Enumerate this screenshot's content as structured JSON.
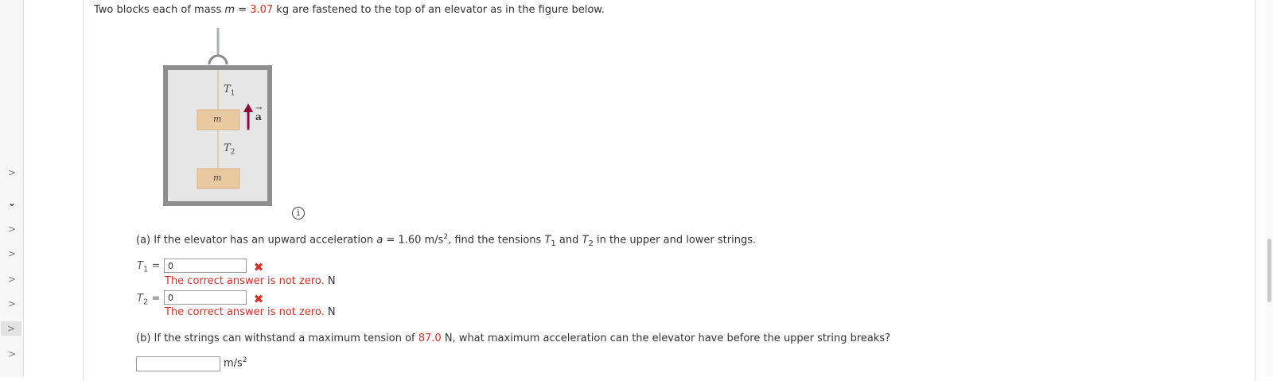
{
  "intro": {
    "prefix": "Two blocks each of mass ",
    "var": "m",
    "eq": " = ",
    "value": "3.07",
    "suffix": " kg are fastened to the top of an elevator as in the figure below."
  },
  "figure": {
    "t1": "T",
    "t1_sub": "1",
    "t2": "T",
    "t2_sub": "2",
    "mass_label": "m",
    "accel_label": "a"
  },
  "info_icon": "i",
  "part_a": {
    "prefix": "(a) If the elevator has an upward acceleration ",
    "var": "a",
    "eq": " = 1.60 m/s",
    "exp": "2",
    "mid": ", find the tensions ",
    "t1": "T",
    "t1_sub": "1",
    "and": " and ",
    "t2": "T",
    "t2_sub": "2",
    "suffix": " in the upper and lower strings.",
    "answers": [
      {
        "label": "T",
        "sub": "1",
        "eq": "=",
        "value": "0",
        "feedback": "The correct answer is not zero.",
        "unit": "N"
      },
      {
        "label": "T",
        "sub": "2",
        "eq": "=",
        "value": "0",
        "feedback": "The correct answer is not zero.",
        "unit": "N"
      }
    ]
  },
  "part_b": {
    "prefix": "(b) If the strings can withstand a maximum tension of ",
    "value": "87.0",
    "suffix": " N, what maximum acceleration can the elevator have before the upper string breaks?",
    "input_value": "",
    "unit": "m/s",
    "unit_exp": "2"
  },
  "rail": {
    "chevrons": [
      ">",
      "⌄",
      ">",
      ">",
      ">",
      ">",
      ">",
      ">"
    ]
  },
  "colors": {
    "accent_red": "#d93025",
    "arrow": "#8b0a3a",
    "block": "#e8c9a0"
  }
}
